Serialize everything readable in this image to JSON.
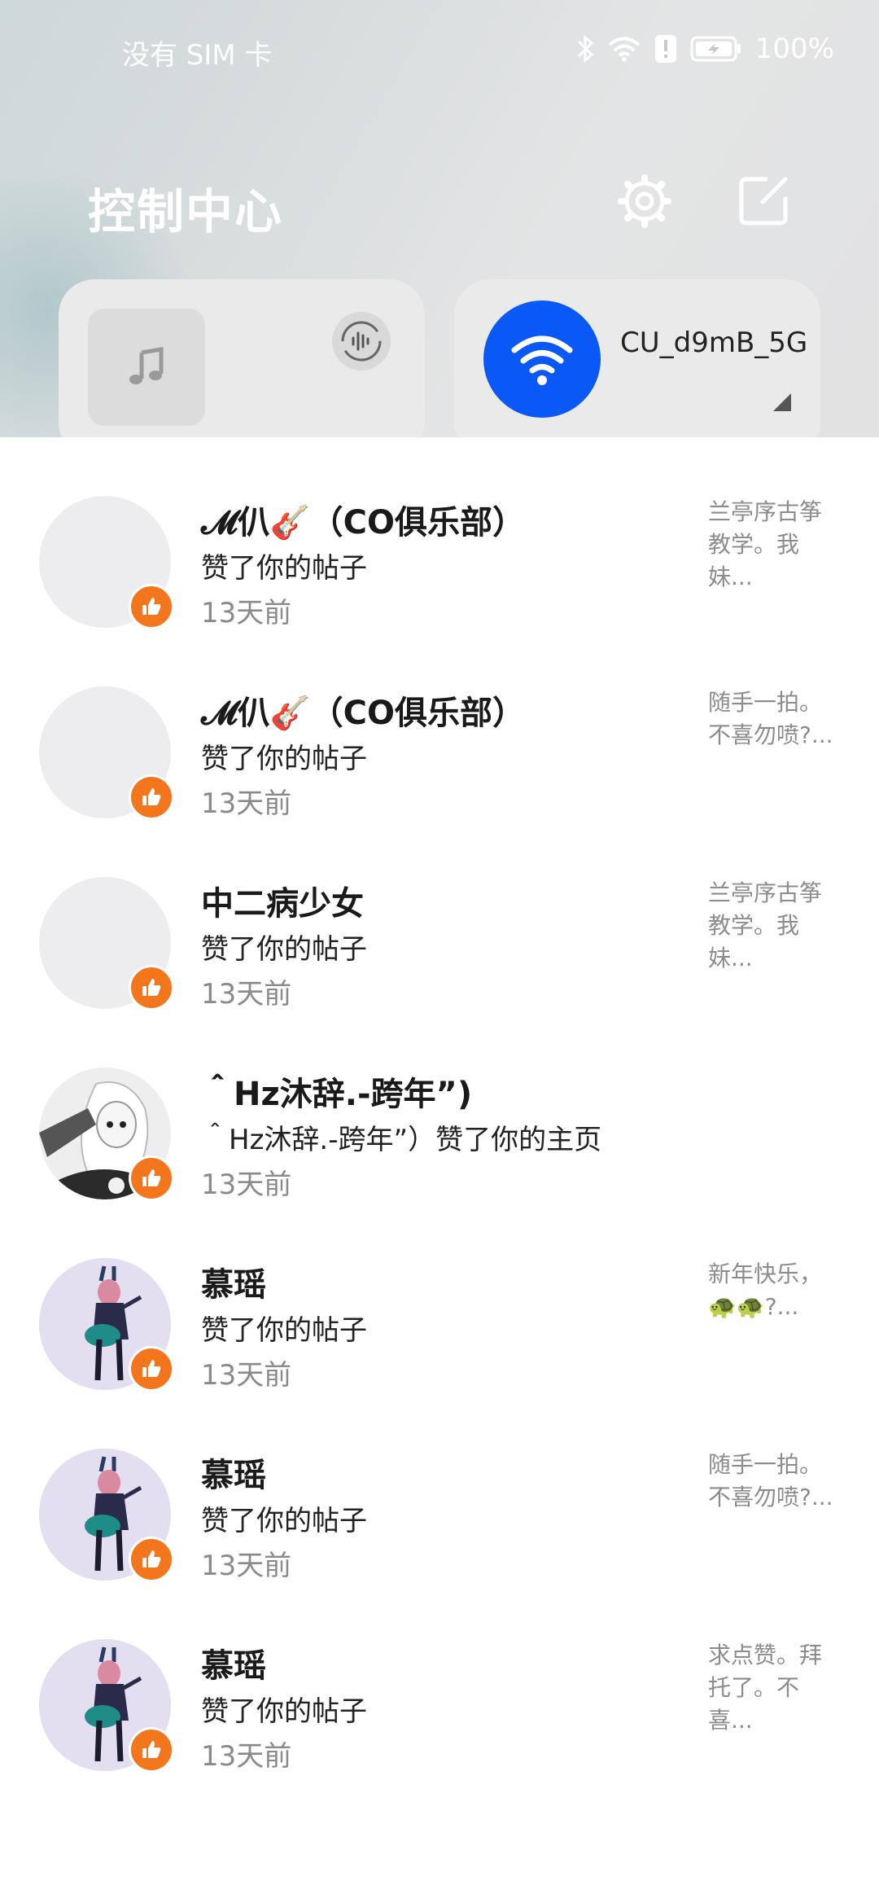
{
  "status_bar": {
    "carrier": "没有 SIM 卡",
    "battery_percent": "100%",
    "icons": [
      "bluetooth-icon",
      "wifi-icon",
      "alert-icon",
      "battery-charging-icon"
    ]
  },
  "control_center": {
    "title": "控制中心",
    "settings_icon": "gear-icon",
    "edit_icon": "edit-icon",
    "media_card": {
      "art_icon": "music-note-icon",
      "action_icon": "audio-wave-icon"
    },
    "wifi_card": {
      "network_name": "CU_d9mB_5G",
      "icon": "wifi-icon",
      "accent": "#0a59f7"
    }
  },
  "notifications": [
    {
      "name": "𝓜仈🎸（CO俱乐部）",
      "action": "赞了你的帖子",
      "time": "13天前",
      "snippet": "兰亭序古筝教学。我妹...",
      "avatar": "blank"
    },
    {
      "name": "𝓜仈🎸（CO俱乐部）",
      "action": "赞了你的帖子",
      "time": "13天前",
      "snippet": "随手一拍。不喜勿喷?...",
      "avatar": "blank"
    },
    {
      "name": "中二病少女",
      "action": "赞了你的帖子",
      "time": "13天前",
      "snippet": "兰亭序古筝教学。我妹...",
      "avatar": "blank"
    },
    {
      "name": "＾Hz沐辞.-跨年”)",
      "action": "＾Hz沐辞.-跨年”）赞了你的主页",
      "time": "13天前",
      "snippet": "",
      "avatar": "anime"
    },
    {
      "name": "慕瑶",
      "action": "赞了你的帖子",
      "time": "13天前",
      "snippet": "新年快乐，🐢🐢?...",
      "avatar": "character"
    },
    {
      "name": "慕瑶",
      "action": "赞了你的帖子",
      "time": "13天前",
      "snippet": "随手一拍。不喜勿喷?...",
      "avatar": "character"
    },
    {
      "name": "慕瑶",
      "action": "赞了你的帖子",
      "time": "13天前",
      "snippet": "求点赞。拜托了。不喜...",
      "avatar": "character"
    }
  ],
  "colors": {
    "like_badge": "#f4761c",
    "time_text": "#8a8a8a"
  }
}
